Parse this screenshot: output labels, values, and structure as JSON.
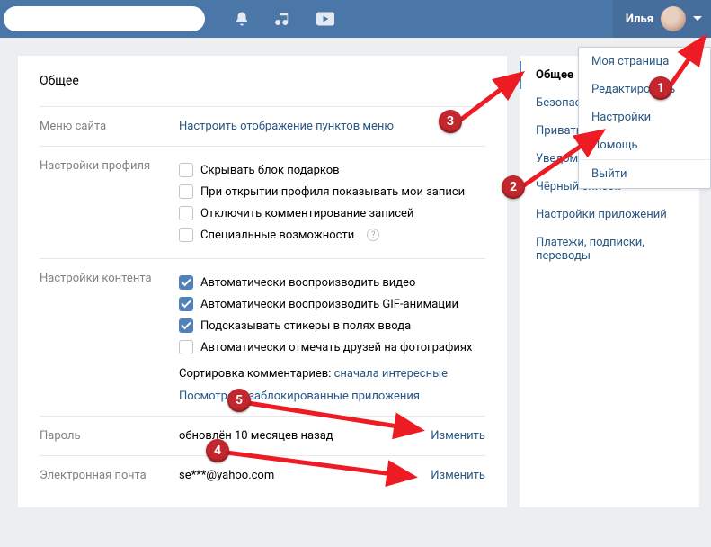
{
  "header": {
    "username": "Илья"
  },
  "page_title": "Общее",
  "menu_row": {
    "label": "Меню сайта",
    "link": "Настроить отображение пунктов меню"
  },
  "profile_row": {
    "label": "Настройки профиля",
    "opts": [
      {
        "text": "Скрывать блок подарков",
        "checked": false
      },
      {
        "text": "При открытии профиля показывать мои записи",
        "checked": false
      },
      {
        "text": "Отключить комментирование записей",
        "checked": false
      },
      {
        "text": "Специальные возможности",
        "checked": false,
        "help": true
      }
    ]
  },
  "content_row": {
    "label": "Настройки контента",
    "opts": [
      {
        "text": "Автоматически воспроизводить видео",
        "checked": true
      },
      {
        "text": "Автоматически воспроизводить GIF-анимации",
        "checked": true
      },
      {
        "text": "Подсказывать стикеры в полях ввода",
        "checked": true
      },
      {
        "text": "Автоматически отмечать друзей на фотографиях",
        "checked": false
      }
    ],
    "sort_label": "Сортировка комментариев:",
    "sort_value": "сначала интересные",
    "blocked": "Посмотреть заблокированные приложения"
  },
  "password_row": {
    "label": "Пароль",
    "value": "обновлён 10 месяцев назад",
    "action": "Изменить"
  },
  "email_row": {
    "label": "Электронная почта",
    "value": "se***@yahoo.com",
    "action": "Изменить"
  },
  "sidebar": {
    "items": [
      {
        "label": "Общее",
        "active": true
      },
      {
        "label": "Безопасность"
      },
      {
        "label": "Приватность"
      },
      {
        "label": "Уведомления"
      },
      {
        "label": "Чёрный список"
      },
      {
        "label": "Настройки приложений"
      },
      {
        "label": "Платежи, подписки, переводы"
      }
    ]
  },
  "dropdown": {
    "items": [
      "Моя страница",
      "Редактировать",
      "Настройки",
      "Помощь",
      "Выйти"
    ]
  },
  "annotations": {
    "n1": "1",
    "n2": "2",
    "n3": "3",
    "n4": "4",
    "n5": "5"
  }
}
